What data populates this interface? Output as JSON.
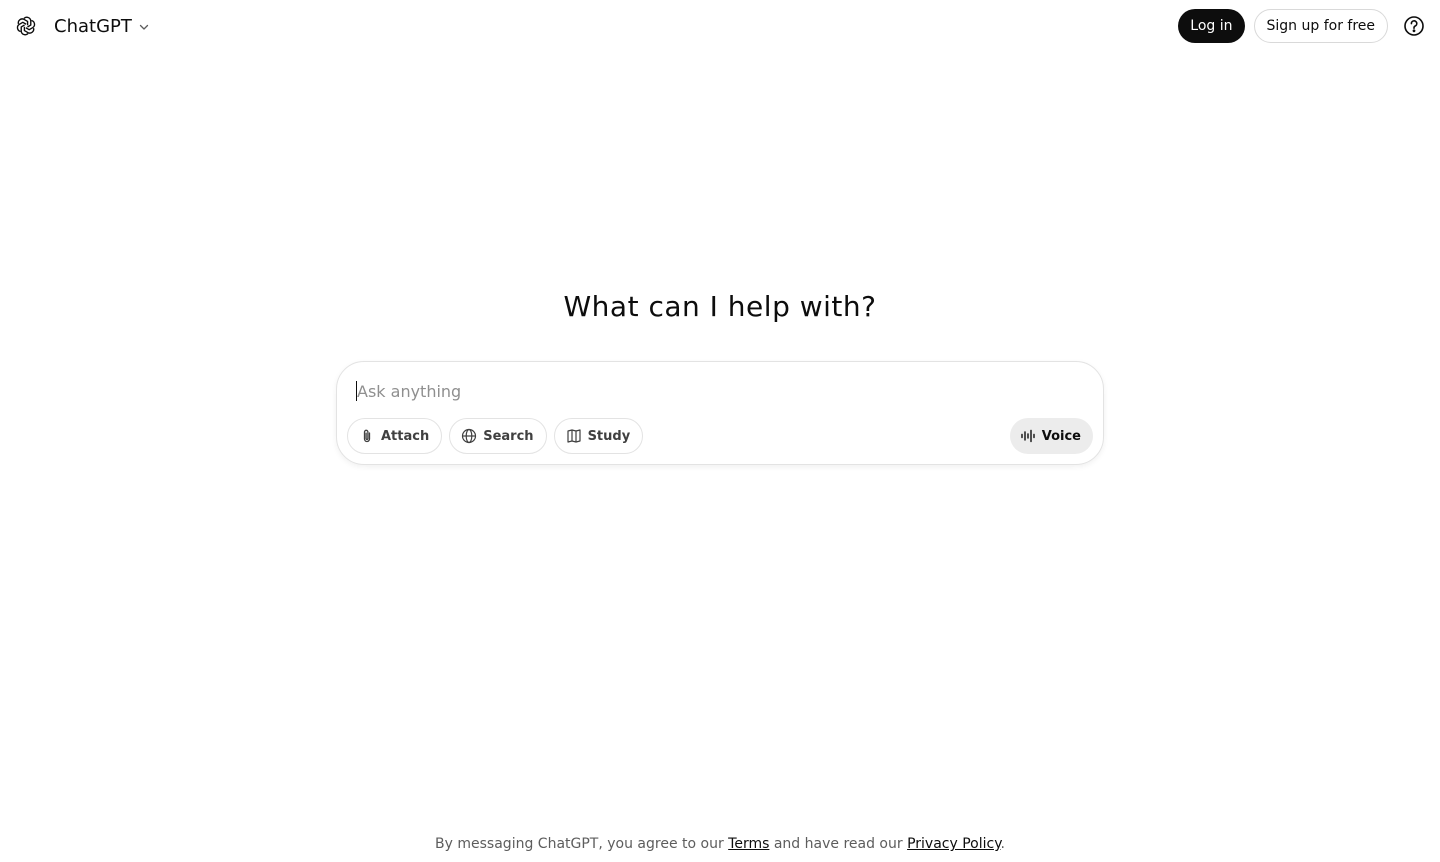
{
  "app": {
    "name": "ChatGPT"
  },
  "header": {
    "model_label": "ChatGPT",
    "login_label": "Log in",
    "signup_label": "Sign up for free"
  },
  "main": {
    "headline": "What can I help with?",
    "composer": {
      "placeholder": "Ask anything",
      "value": "",
      "tools": [
        {
          "label": "Attach",
          "icon": "paperclip-icon"
        },
        {
          "label": "Search",
          "icon": "globe-icon"
        },
        {
          "label": "Study",
          "icon": "book-icon"
        }
      ],
      "voice_label": "Voice"
    }
  },
  "footer": {
    "prefix": "By messaging ChatGPT, you agree to our ",
    "terms_label": "Terms",
    "middle": " and have read our ",
    "privacy_label": "Privacy Policy",
    "suffix": "."
  },
  "colors": {
    "primary": "#0d0d0d",
    "border": "#e3e3e3",
    "voice_bg": "#ececec",
    "muted_text": "#5d5d5d"
  }
}
